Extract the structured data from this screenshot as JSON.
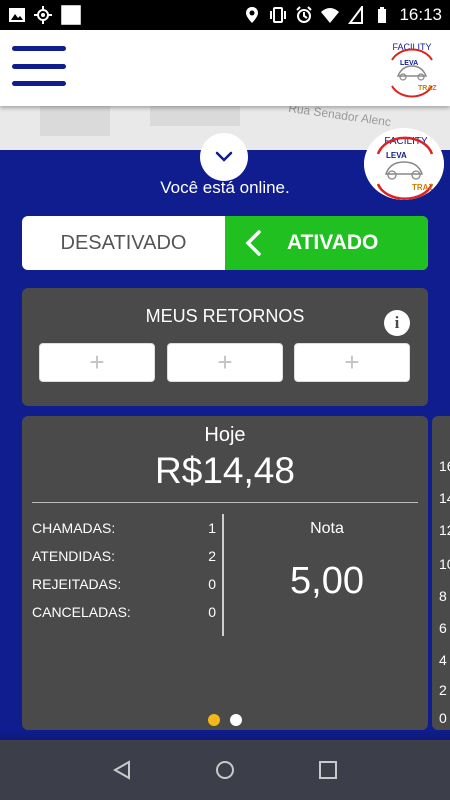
{
  "status_bar": {
    "time": "16:13",
    "left_icons": [
      "image-icon",
      "gps-icon",
      "blank-square-icon"
    ],
    "right_icons": [
      "location-icon",
      "vibrate-icon",
      "alarm-icon",
      "wifi-icon",
      "no-sim-icon",
      "battery-icon"
    ]
  },
  "header": {
    "logo_lines": [
      "FACILITY",
      "LEVA",
      "TRAZ"
    ]
  },
  "map": {
    "street": "Rua Senador Alenc"
  },
  "panel": {
    "online_status": "Você está online.",
    "logo_lines": [
      "FACILITY",
      "LEVA",
      "TRAZ"
    ]
  },
  "toggle": {
    "off_label": "DESATIVADO",
    "on_label": "ATIVADO"
  },
  "returns": {
    "title": "MEUS RETORNOS",
    "info_symbol": "i",
    "slots": [
      "+",
      "+",
      "+"
    ]
  },
  "today": {
    "label": "Hoje",
    "amount": "R$14,48",
    "stats": [
      {
        "label": "CHAMADAS:",
        "value": "1"
      },
      {
        "label": "ATENDIDAS:",
        "value": "2"
      },
      {
        "label": "REJEITADAS:",
        "value": "0"
      },
      {
        "label": "CANCELADAS:",
        "value": "0"
      }
    ],
    "rating_label": "Nota",
    "rating_value": "5,00",
    "pages": 2,
    "active_page": 1
  },
  "next_card_peek": [
    "16",
    "14",
    "12",
    "10",
    "8",
    "6",
    "4",
    "2",
    "0"
  ],
  "colors": {
    "brand_blue": "#0f1d8f",
    "active_green": "#1fc01f",
    "card_gray": "#4a4a4a",
    "page_dot_active": "#f5b81a"
  }
}
